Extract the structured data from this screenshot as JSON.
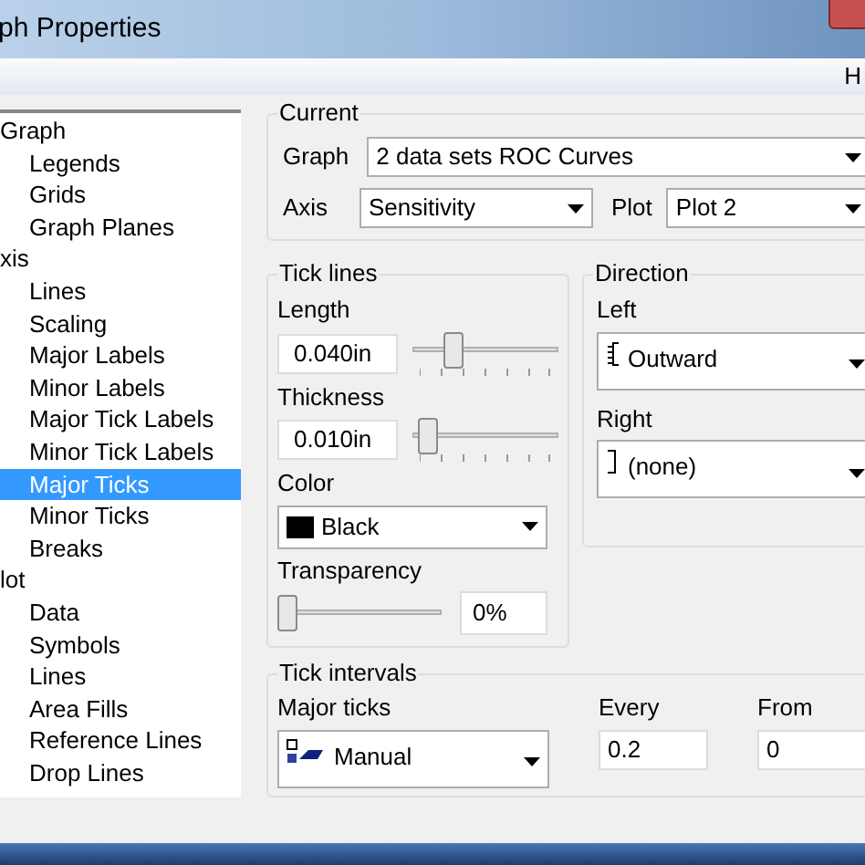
{
  "window": {
    "title": "ph Properties"
  },
  "toolbar": {
    "help": "H"
  },
  "tree": [
    {
      "label": "Graph",
      "selected": false,
      "children": [
        {
          "label": "Legends",
          "selected": false
        },
        {
          "label": "Grids",
          "selected": false
        },
        {
          "label": "Graph Planes",
          "selected": false
        }
      ]
    },
    {
      "label": "xis",
      "selected": false,
      "children": [
        {
          "label": "Lines",
          "selected": false
        },
        {
          "label": "Scaling",
          "selected": false
        },
        {
          "label": "Major Labels",
          "selected": false
        },
        {
          "label": "Minor Labels",
          "selected": false
        },
        {
          "label": "Major Tick Labels",
          "selected": false
        },
        {
          "label": "Minor Tick Labels",
          "selected": false
        },
        {
          "label": "Major Ticks",
          "selected": true
        },
        {
          "label": "Minor Ticks",
          "selected": false
        },
        {
          "label": "Breaks",
          "selected": false
        }
      ]
    },
    {
      "label": "lot",
      "selected": false,
      "children": [
        {
          "label": "Data",
          "selected": false
        },
        {
          "label": "Symbols",
          "selected": false
        },
        {
          "label": "Lines",
          "selected": false
        },
        {
          "label": "Area Fills",
          "selected": false
        },
        {
          "label": "Reference Lines",
          "selected": false
        },
        {
          "label": "Drop Lines",
          "selected": false
        }
      ]
    }
  ],
  "current": {
    "title": "Current",
    "graph_label": "Graph",
    "graph": "2 data sets ROC Curves",
    "axis_label": "Axis",
    "axis": "Sensitivity",
    "plot_label": "Plot",
    "plot": "Plot 2"
  },
  "tick_lines": {
    "title": "Tick lines",
    "length_label": "Length",
    "length": "0.040in",
    "length_slider": {
      "level": 0.25
    },
    "thickness_label": "Thickness",
    "thickness": "0.010in",
    "thickness_slider": {
      "level": 0.05
    },
    "color_label": "Color",
    "color_name": "Black",
    "color": "#000000",
    "transparency_label": "Transparency",
    "transparency_slider": {
      "level": 0
    },
    "transparency": "0%"
  },
  "direction": {
    "title": "Direction",
    "left_label": "Left",
    "left": "Outward",
    "right_label": "Right",
    "right": "(none)"
  },
  "tick_intervals": {
    "title": "Tick intervals",
    "major_label": "Major ticks",
    "major": "Manual",
    "every_label": "Every",
    "every": "0.2",
    "from_label": "From",
    "from": "0"
  }
}
